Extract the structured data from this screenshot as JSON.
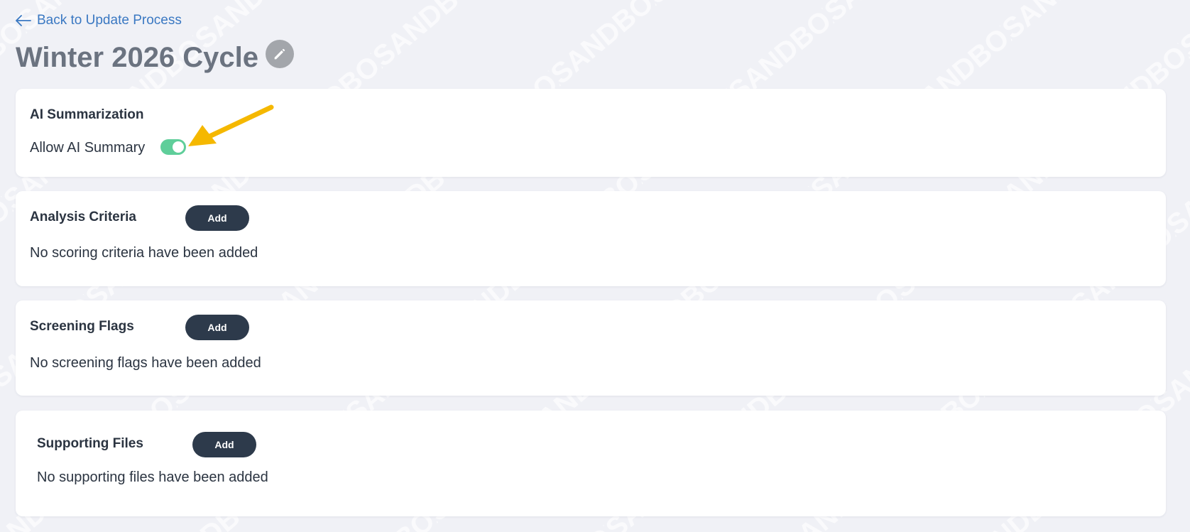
{
  "watermark": {
    "text": "SANDBOX"
  },
  "nav": {
    "back_label": "Back to Update Process"
  },
  "header": {
    "title": "Winter 2026 Cycle"
  },
  "ai_summarization": {
    "title": "AI Summarization",
    "toggle_label": "Allow AI Summary",
    "toggle_on": true
  },
  "analysis_criteria": {
    "title": "Analysis Criteria",
    "add_label": "Add",
    "empty_text": "No scoring criteria have been added"
  },
  "screening_flags": {
    "title": "Screening Flags",
    "add_label": "Add",
    "empty_text": "No screening flags have been added"
  },
  "supporting_files": {
    "title": "Supporting Files",
    "add_label": "Add",
    "empty_text": "No supporting files have been added"
  },
  "colors": {
    "background": "#f0f1f6",
    "link": "#3a78c2",
    "button": "#2d3a4b",
    "toggle_on": "#5fce9a",
    "annotation_arrow": "#f5b800"
  }
}
